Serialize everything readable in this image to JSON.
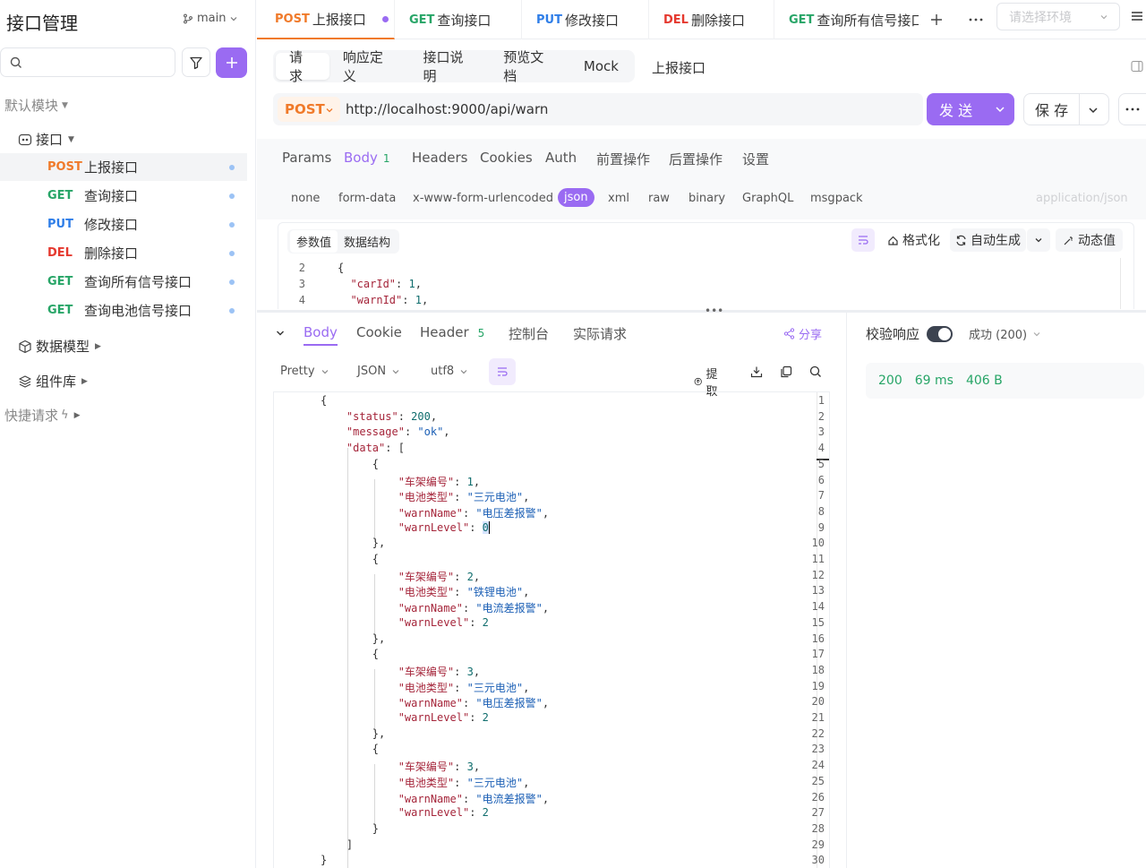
{
  "sidebar": {
    "title": "接口管理",
    "branch": "main",
    "module": "默认模块",
    "folder": "接口",
    "items": [
      {
        "method": "POST",
        "name": "上报接口",
        "active": true
      },
      {
        "method": "GET",
        "name": "查询接口"
      },
      {
        "method": "PUT",
        "name": "修改接口"
      },
      {
        "method": "DEL",
        "name": "删除接口"
      },
      {
        "method": "GET",
        "name": "查询所有信号接口"
      },
      {
        "method": "GET",
        "name": "查询电池信号接口"
      }
    ],
    "data_model": "数据模型",
    "components": "组件库",
    "quick_request": "快捷请求"
  },
  "tabs": [
    {
      "method": "POST",
      "name": "上报接口"
    },
    {
      "method": "GET",
      "name": "查询接口"
    },
    {
      "method": "PUT",
      "name": "修改接口"
    },
    {
      "method": "DEL",
      "name": "删除接口"
    },
    {
      "method": "GET",
      "name": "查询所有信号接口"
    }
  ],
  "env_placeholder": "请选择环境",
  "subtabs": [
    "请求",
    "响应定义",
    "接口说明",
    "预览文档",
    "Mock"
  ],
  "api_name": "上报接口",
  "url": {
    "method": "POST",
    "value": "http://localhost:9000/api/warn"
  },
  "send_label": "发 送",
  "save_label": "保 存",
  "request_tabs": [
    {
      "label": "Params"
    },
    {
      "label": "Body",
      "count": "1"
    },
    {
      "label": "Headers"
    },
    {
      "label": "Cookies"
    },
    {
      "label": "Auth"
    },
    {
      "label": "前置操作"
    },
    {
      "label": "后置操作"
    },
    {
      "label": "设置"
    }
  ],
  "body_types": [
    "none",
    "form-data",
    "x-www-form-urlencoded",
    "json",
    "xml",
    "raw",
    "binary",
    "GraphQL",
    "msgpack"
  ],
  "content_type": "application/json",
  "editor_toolbar": {
    "seg": [
      "参数值",
      "数据结构"
    ],
    "format": "格式化",
    "autogen": "自动生成",
    "dynamic": "动态值"
  },
  "request_code": [
    {
      "n": "2",
      "line": "{"
    },
    {
      "n": "3",
      "line": "  \"carId\": 1,"
    },
    {
      "n": "4",
      "line": "  \"warnId\": 1,"
    }
  ],
  "response_tabs": [
    {
      "label": "Body"
    },
    {
      "label": "Cookie"
    },
    {
      "label": "Header",
      "count": "5"
    },
    {
      "label": "控制台"
    },
    {
      "label": "实际请求"
    }
  ],
  "share": "分享",
  "verify_label": "校验响应",
  "success_label": "成功 (200)",
  "stats": {
    "status": "200",
    "time": "69 ms",
    "size": "406 B"
  },
  "response_opts": {
    "pretty": "Pretty",
    "format": "JSON",
    "encoding": "utf8",
    "extract": "提取"
  },
  "response_code": [
    "{",
    "    \"status\": 200,",
    "    \"message\": \"ok\",",
    "    \"data\": [",
    "        {",
    "            \"车架编号\": 1,",
    "            \"电池类型\": \"三元电池\",",
    "            \"warnName\": \"电压差报警\",",
    "            \"warnLevel\": 0",
    "        },",
    "        {",
    "            \"车架编号\": 2,",
    "            \"电池类型\": \"铁锂电池\",",
    "            \"warnName\": \"电流差报警\",",
    "            \"warnLevel\": 2",
    "        },",
    "        {",
    "            \"车架编号\": 3,",
    "            \"电池类型\": \"三元电池\",",
    "            \"warnName\": \"电压差报警\",",
    "            \"warnLevel\": 2",
    "        },",
    "        {",
    "            \"车架编号\": 3,",
    "            \"电池类型\": \"三元电池\",",
    "            \"warnName\": \"电流差报警\",",
    "            \"warnLevel\": 2",
    "        }",
    "    ]",
    "}"
  ],
  "colors": {
    "accent": "#9a6bf2",
    "post": "#f07a2a",
    "get": "#27a567",
    "put": "#2f7ee8",
    "del": "#e5392f"
  }
}
